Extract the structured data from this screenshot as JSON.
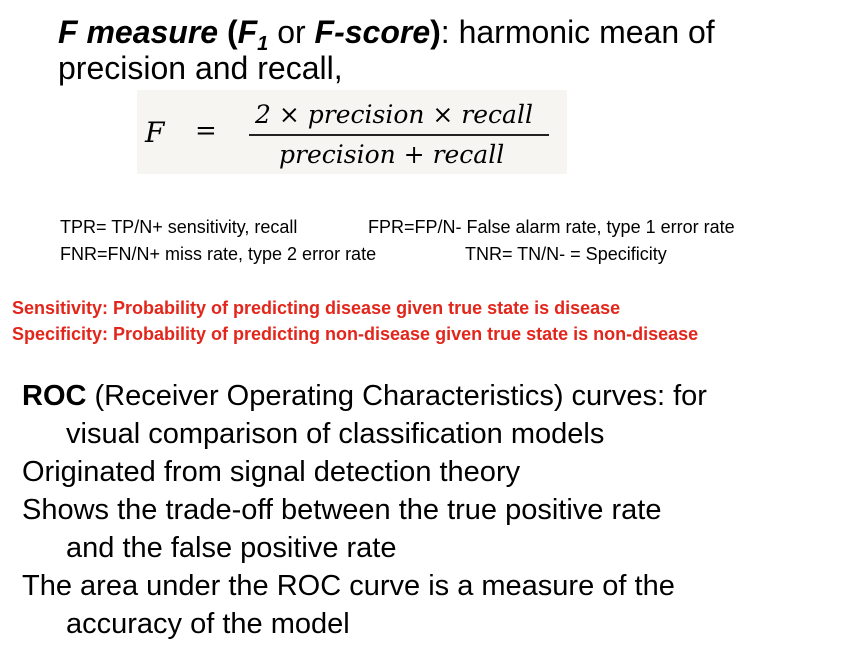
{
  "fmeasure": {
    "term": "F measure",
    "open_paren": " (",
    "f_symbol": "F",
    "subscript": "1",
    "or_text": " or ",
    "fscore": "F-score",
    "close_paren": ")",
    "rest_line1": ": harmonic mean of",
    "line2": "precision and recall,"
  },
  "formula": {
    "lhs": "F",
    "eq": "=",
    "numerator": "2 × precision × recall",
    "denominator": "precision + recall"
  },
  "rates": {
    "tpr": "TPR= TP/N+ sensitivity, recall",
    "fpr": "FPR=FP/N-   False alarm rate, type 1 error rate",
    "fnr": "FNR=FN/N+  miss rate, type 2 error rate",
    "tnr": "TNR= TN/N- = Specificity"
  },
  "definitions": {
    "sensitivity": "Sensitivity: Probability of predicting  disease given true state is disease",
    "specificity": "Specificity: Probability of predicting non-disease given true state is non-disease"
  },
  "roc": {
    "term": "ROC",
    "line1_rest": " (Receiver Operating Characteristics) curves: for",
    "line2": "visual comparison of classification models",
    "line3": "Originated from signal detection theory",
    "line4": "Shows the trade-off between the true positive rate",
    "line5": "and the false positive rate",
    "line6": "The area under the ROC curve is a measure of the",
    "line7": "accuracy of the model"
  }
}
